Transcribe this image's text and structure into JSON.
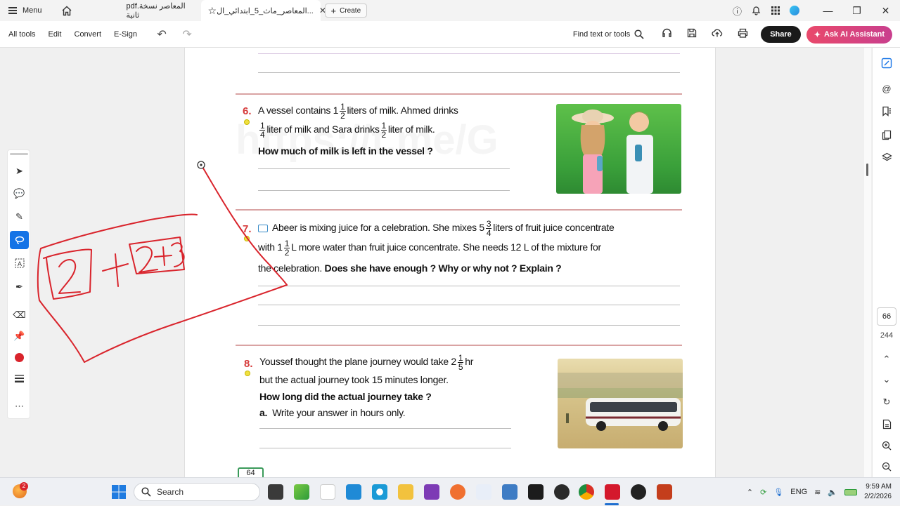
{
  "titlebar": {
    "menu_label": "Menu",
    "tabs": [
      {
        "label": "pdf.المعاصر نسخة ثانية"
      },
      {
        "label": "المعاصر_ماث_5_ابتدائي_ال..."
      }
    ],
    "create_label": "Create"
  },
  "toolbar": {
    "items": [
      "All tools",
      "Edit",
      "Convert",
      "E-Sign"
    ],
    "find_label": "Find text or tools",
    "share_label": "Share",
    "ai_label": "Ask AI Assistant"
  },
  "document": {
    "watermark": "https://t.me/G",
    "q6": {
      "number": "6.",
      "line1_a": "A vessel contains 1",
      "line1_frac": {
        "num": "1",
        "den": "2"
      },
      "line1_b": "liters of milk. Ahmed drinks",
      "line2_frac1": {
        "num": "1",
        "den": "4"
      },
      "line2_a": "liter of milk and Sara drinks",
      "line2_frac2": {
        "num": "1",
        "den": "2"
      },
      "line2_b": "liter of milk.",
      "question": "How much of milk is left in the vessel ?"
    },
    "q7": {
      "number": "7.",
      "line1_a": "Abeer is mixing juice for a celebration. She mixes 5",
      "line1_frac": {
        "num": "3",
        "den": "4"
      },
      "line1_b": "liters of fruit juice concentrate",
      "line2_a": "with 1",
      "line2_frac": {
        "num": "1",
        "den": "2"
      },
      "line2_b": "L more water than fruit juice concentrate. She needs 12 L of the mixture for",
      "line3_a": "the celebration.",
      "line3_b": "Does she have enough ? Why or why not ? Explain ?"
    },
    "q8": {
      "number": "8.",
      "line1_a": "Youssef thought the plane journey would take 2",
      "line1_frac": {
        "num": "1",
        "den": "5"
      },
      "line1_b": "hr",
      "line2": "but the actual journey took 15 minutes longer.",
      "question": "How long did the actual journey take ?",
      "part_label": "a.",
      "part_text": "Write your answer in hours only."
    },
    "page_number": "64"
  },
  "annotation_colors": {
    "ink": "#d9242c"
  },
  "right_rail": {
    "current_page": "66",
    "total_pages": "244"
  },
  "taskbar": {
    "search_placeholder": "Search",
    "notification_count": "2",
    "language": "ENG",
    "time": "9:59 AM",
    "date": "2/2/2026"
  }
}
